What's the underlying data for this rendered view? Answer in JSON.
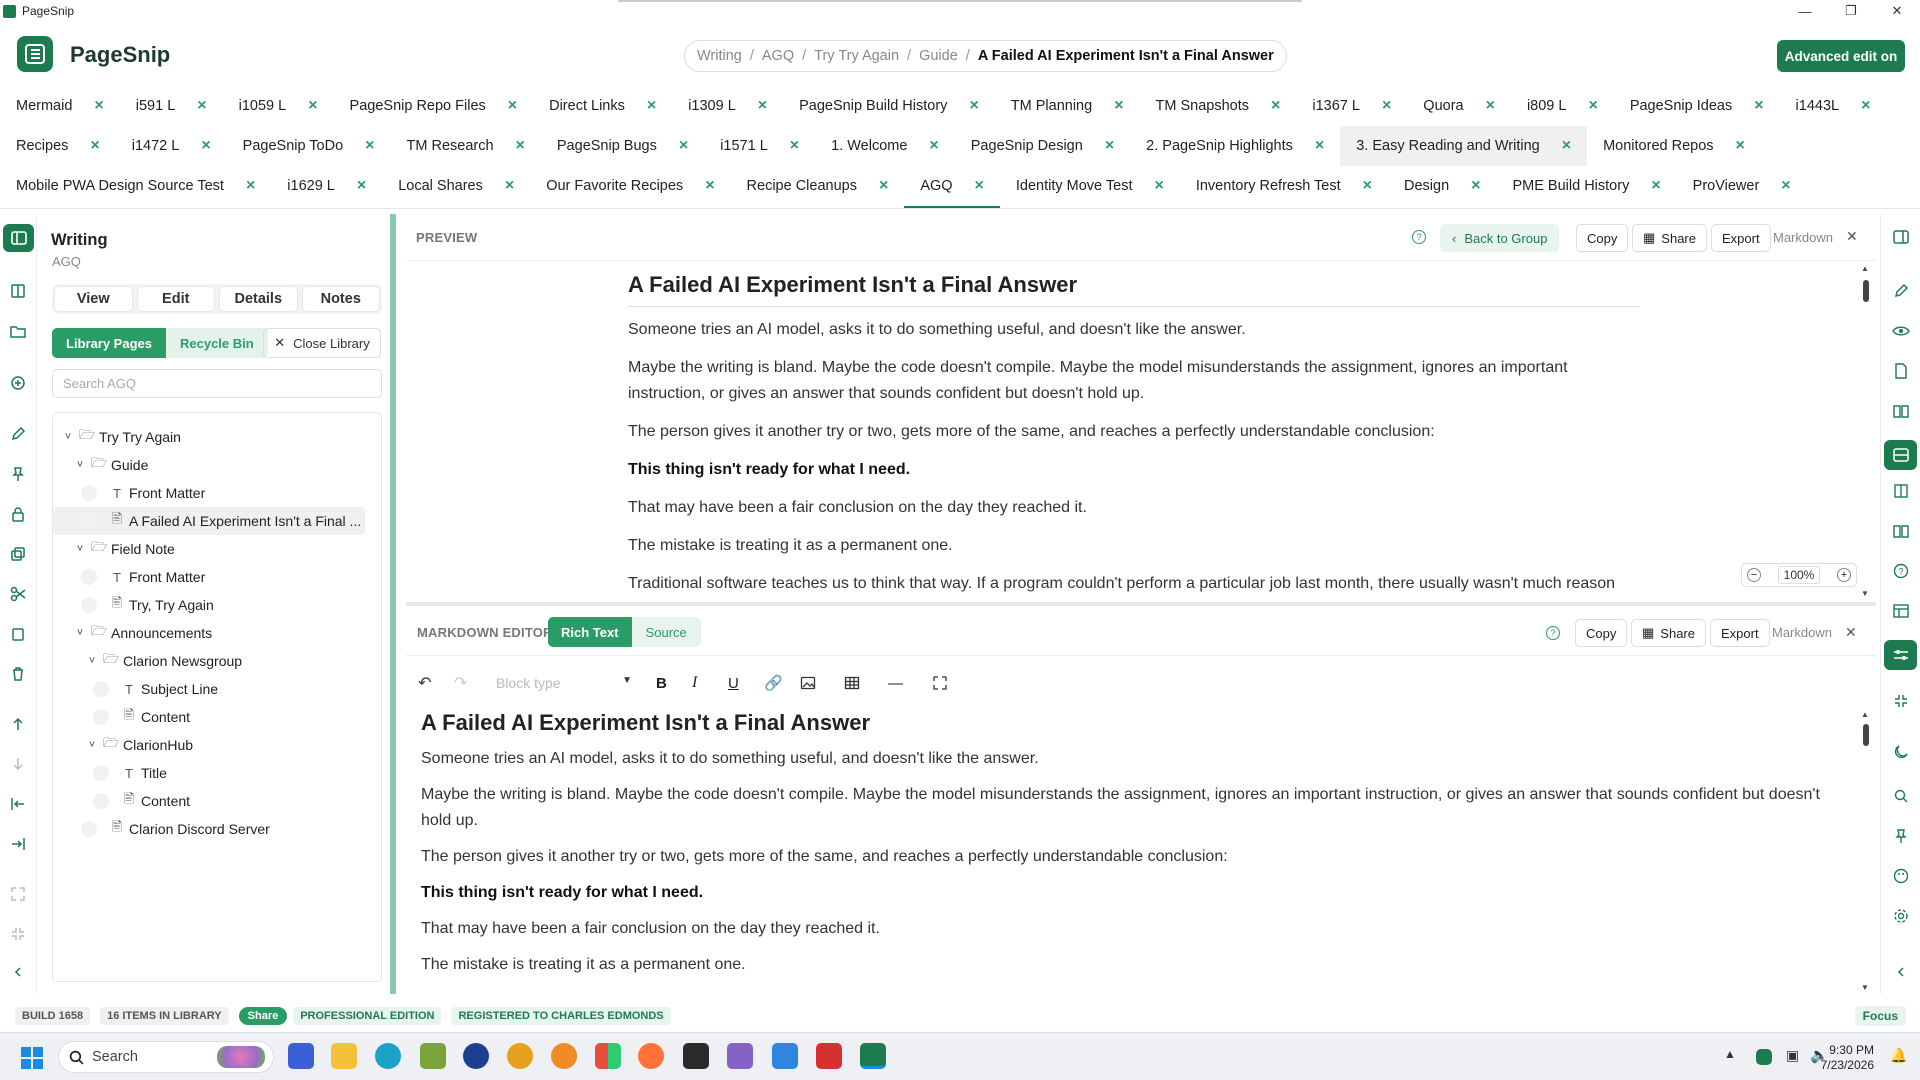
{
  "window": {
    "title": "PageSnip"
  },
  "header": {
    "app_name": "PageSnip",
    "breadcrumb": [
      "Writing",
      "AGQ",
      "Try Try Again",
      "Guide"
    ],
    "breadcrumb_current": "A Failed AI Experiment Isn't a Final Answer",
    "advanced_button": "Advanced edit on"
  },
  "tabs": {
    "row1": [
      "Mermaid",
      "i591 L",
      "i1059 L",
      "PageSnip Repo Files",
      "Direct Links",
      "i1309 L",
      "PageSnip Build History",
      "TM Planning",
      "TM Snapshots",
      "i1367 L",
      "Quora",
      "i809 L",
      "PageSnip Ideas",
      "i1443L"
    ],
    "row2": [
      "Recipes",
      "i1472 L",
      "PageSnip ToDo",
      "TM Research",
      "PageSnip Bugs",
      "i1571 L",
      "1. Welcome",
      "PageSnip Design",
      "2. PageSnip Highlights",
      "3. Easy Reading and Writing",
      "Monitored Repos"
    ],
    "row3": [
      "Mobile PWA Design Source Test",
      "i1629 L",
      "Local Shares",
      "Our Favorite Recipes",
      "Recipe Cleanups",
      "AGQ",
      "Identity Move Test",
      "Inventory Refresh Test",
      "Design",
      "PME Build History",
      "ProViewer"
    ],
    "close_glyph": "×",
    "active": "AGQ"
  },
  "library": {
    "title": "Writing",
    "subtitle": "AGQ",
    "view_tabs": [
      "View",
      "Edit",
      "Details",
      "Notes"
    ],
    "library_pages": "Library Pages",
    "recycle_bin": "Recycle Bin",
    "close_library": "Close Library",
    "search_placeholder": "Search AGQ",
    "tree": [
      {
        "label": "Try Try Again",
        "kind": "folder"
      },
      {
        "label": "Guide",
        "kind": "folder"
      },
      {
        "label": "Front Matter",
        "kind": "text"
      },
      {
        "label": "A Failed AI Experiment Isn't a Final ...",
        "kind": "doc",
        "selected": true
      },
      {
        "label": "Field Note",
        "kind": "folder"
      },
      {
        "label": "Front Matter",
        "kind": "text"
      },
      {
        "label": "Try, Try Again",
        "kind": "doc"
      },
      {
        "label": "Announcements",
        "kind": "folder"
      },
      {
        "label": "Clarion Newsgroup",
        "kind": "folder"
      },
      {
        "label": "Subject Line",
        "kind": "text"
      },
      {
        "label": "Content",
        "kind": "doc"
      },
      {
        "label": "ClarionHub",
        "kind": "folder"
      },
      {
        "label": "Title",
        "kind": "text"
      },
      {
        "label": "Content",
        "kind": "doc"
      },
      {
        "label": "Clarion Discord Server",
        "kind": "doc"
      }
    ]
  },
  "preview": {
    "label": "PREVIEW",
    "back_to_group": "Back to Group",
    "copy": "Copy",
    "share": "Share",
    "export": "Export",
    "markdown": "Markdown",
    "zoom": "100%",
    "title": "A Failed AI Experiment Isn't a Final Answer",
    "paragraphs": [
      "Someone tries an AI model, asks it to do something useful, and doesn't like the answer.",
      "Maybe the writing is bland. Maybe the code doesn't compile. Maybe the model misunderstands the assignment, ignores an important instruction, or gives an answer that sounds confident but doesn't hold up.",
      "The person gives it another try or two, gets more of the same, and reaches a perfectly understandable conclusion:",
      "This thing isn't ready for what I need.",
      "That may have been a fair conclusion on the day they reached it.",
      "The mistake is treating it as a permanent one.",
      "Traditional software teaches us to think that way. If a program couldn't perform a particular job last month, there usually wasn't much reason"
    ]
  },
  "editor": {
    "label": "MARKDOWN EDITOR",
    "rich_text": "Rich Text",
    "source": "Source",
    "copy": "Copy",
    "share": "Share",
    "export": "Export",
    "markdown": "Markdown",
    "block_type": "Block type",
    "title": "A Failed AI Experiment Isn't a Final Answer",
    "paragraphs": [
      "Someone tries an AI model, asks it to do something useful, and doesn't like the answer.",
      "Maybe the writing is bland. Maybe the code doesn't compile. Maybe the model misunderstands the assignment, ignores an important instruction, or gives an answer that sounds confident but doesn't hold up.",
      "The person gives it another try or two, gets more of the same, and reaches a perfectly understandable conclusion:",
      "This thing isn't ready for what I need.",
      "That may have been a fair conclusion on the day they reached it.",
      "The mistake is treating it as a permanent one."
    ]
  },
  "status": {
    "build": "BUILD 1658",
    "items": "16 ITEMS IN LIBRARY",
    "share": "Share",
    "edition": "PROFESSIONAL EDITION",
    "registered": "REGISTERED TO CHARLES EDMONDS",
    "focus": "Focus"
  },
  "taskbar": {
    "search": "Search",
    "time": "9:30 PM",
    "date": "7/23/2026"
  },
  "colors": {
    "accent": "#1e7b4f",
    "accent_light": "#2a9d66"
  }
}
